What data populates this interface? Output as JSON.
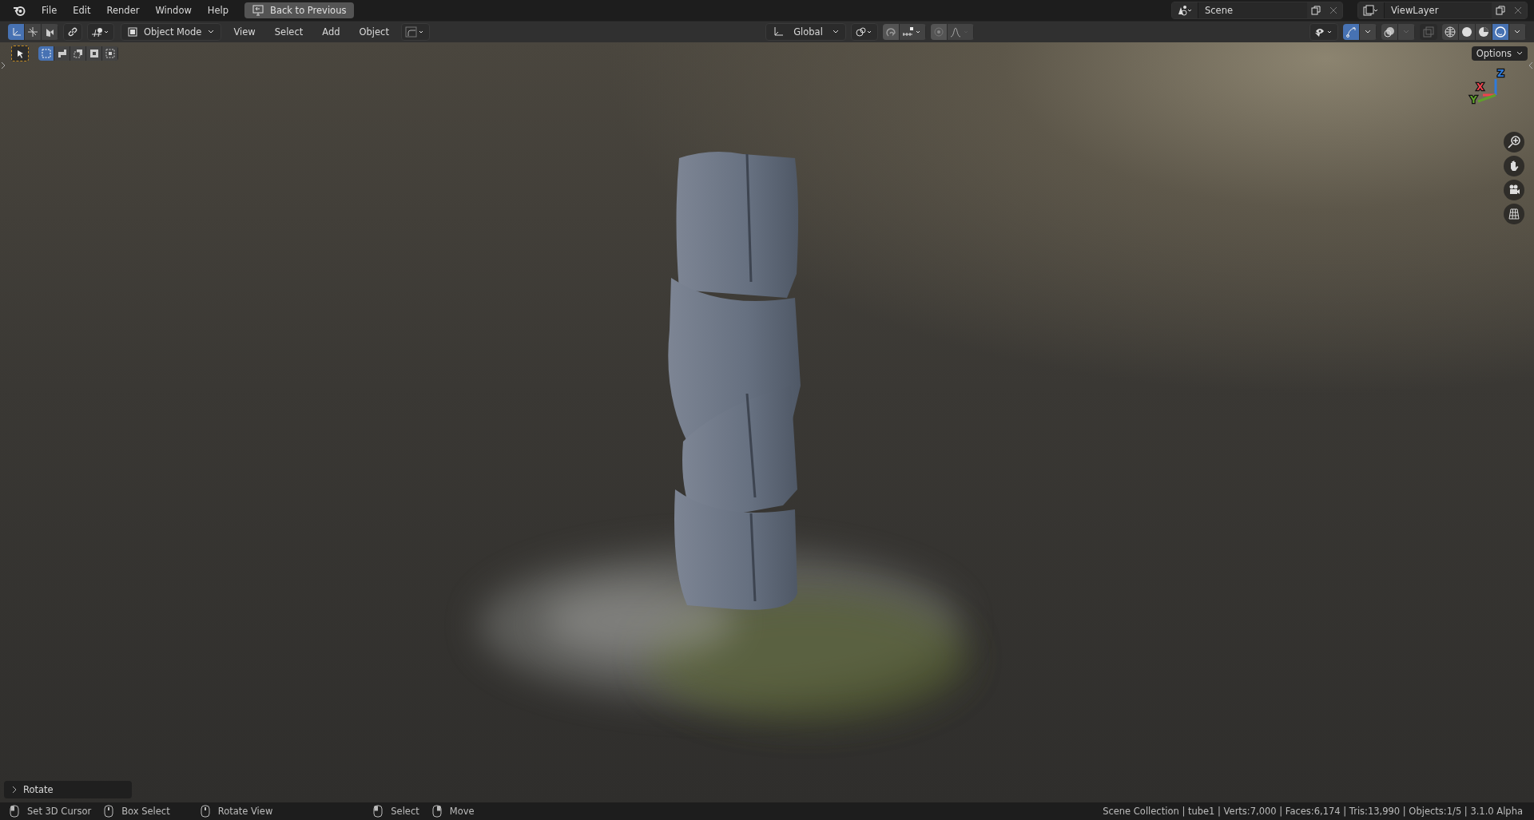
{
  "menu": [
    "File",
    "Edit",
    "Render",
    "Window",
    "Help"
  ],
  "back_button": "Back to Previous",
  "scene": {
    "name": "Scene"
  },
  "view_layer": {
    "name": "ViewLayer"
  },
  "header": {
    "transform_tools": [
      {
        "selected": true
      },
      {
        "selected": false
      },
      {
        "selected": false
      }
    ],
    "mode": "Object Mode",
    "menus": [
      "View",
      "Select",
      "Add",
      "Object"
    ],
    "orientation": "Global",
    "gizmos_on": true,
    "shading_modes": [
      {
        "selected": false
      },
      {
        "selected": false
      },
      {
        "selected": false
      },
      {
        "selected": true
      }
    ]
  },
  "tool_settings": {
    "select_modes": [
      {
        "selected": true
      },
      {
        "selected": false
      },
      {
        "selected": false
      },
      {
        "selected": false
      },
      {
        "selected": false
      }
    ],
    "options": "Options"
  },
  "axes": [
    {
      "label": "Z",
      "color": "#2f7bdc"
    },
    {
      "label": "X",
      "color": "#f0434d"
    },
    {
      "label": "Y",
      "color": "#5fa02a"
    }
  ],
  "last_operator": "Rotate",
  "status_hints": [
    {
      "kind": "left",
      "label": "Set 3D Cursor"
    },
    {
      "kind": "middle",
      "label": "Box Select"
    },
    {
      "kind": "middle",
      "label": "Rotate View"
    },
    {
      "kind": "left",
      "label": "Select"
    },
    {
      "kind": "right",
      "label": "Move"
    }
  ],
  "status_info": "Scene Collection | tube1 | Verts:7,000 | Faces:6,174 | Tris:13,990 | Objects:1/5 | 3.1.0 Alpha"
}
